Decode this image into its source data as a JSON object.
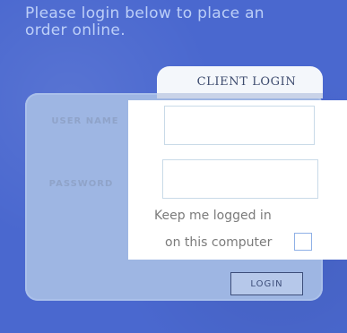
{
  "header": {
    "prompt": "Please login below to place an order online."
  },
  "login": {
    "title": "CLIENT LOGIN",
    "username_label": "USER NAME",
    "password_label": "PASSWORD",
    "remember_line1": "Keep me logged in",
    "remember_line2": "on this computer",
    "submit_label": "LOGIN"
  },
  "colors": {
    "background": "#4a68cf",
    "card": "#9eb6e3",
    "panel": "#ffffff",
    "text_muted": "#7b7b7b"
  }
}
